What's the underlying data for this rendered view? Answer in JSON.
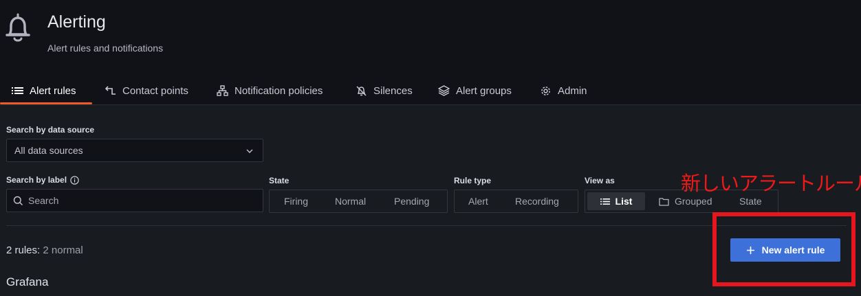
{
  "header": {
    "title": "Alerting",
    "subtitle": "Alert rules and notifications",
    "icon": "bell-icon"
  },
  "tabs": [
    {
      "label": "Alert rules",
      "icon": "list-icon",
      "active": true
    },
    {
      "label": "Contact points",
      "icon": "contact-icon"
    },
    {
      "label": "Notification policies",
      "icon": "sitemap-icon"
    },
    {
      "label": "Silences",
      "icon": "bell-slash-icon"
    },
    {
      "label": "Alert groups",
      "icon": "layers-icon"
    },
    {
      "label": "Admin",
      "icon": "cog-icon"
    }
  ],
  "filters": {
    "datasource": {
      "label": "Search by data source",
      "value": "All data sources"
    },
    "label_search": {
      "label": "Search by label",
      "placeholder": "Search"
    },
    "state": {
      "label": "State",
      "options": [
        "Firing",
        "Normal",
        "Pending"
      ]
    },
    "rule_type": {
      "label": "Rule type",
      "options": [
        "Alert",
        "Recording"
      ]
    },
    "view_as": {
      "label": "View as",
      "options": [
        "List",
        "Grouped",
        "State"
      ],
      "selected": "List"
    }
  },
  "summary": {
    "count": "2 rules:",
    "detail": "2 normal"
  },
  "new_rule_button": "New alert rule",
  "section_title": "Grafana",
  "annotation": {
    "text": "新しいアラートルール",
    "color": "#e5161d"
  },
  "colors": {
    "accent": "#f05a28",
    "primary": "#3d71d9",
    "background": "#111217"
  }
}
